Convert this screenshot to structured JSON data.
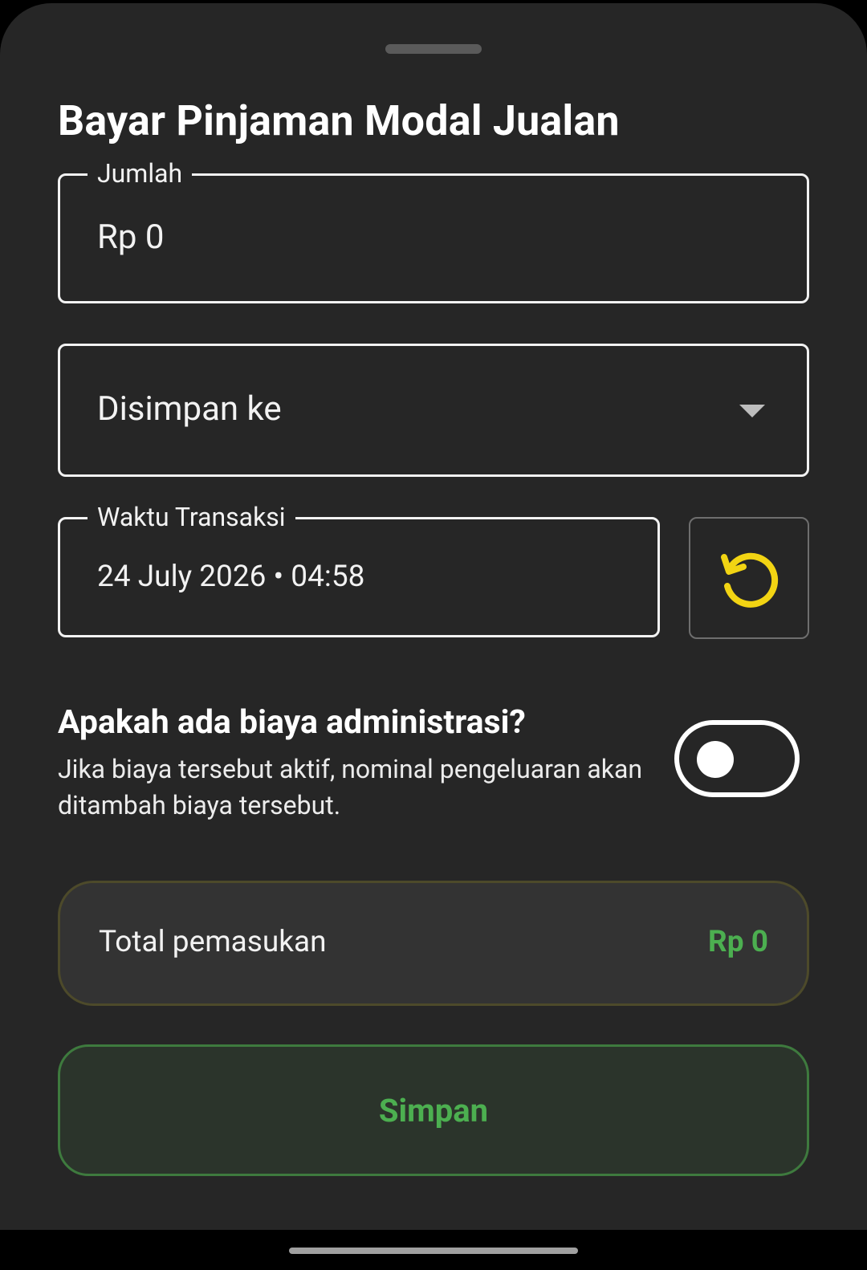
{
  "sheet": {
    "title": "Bayar Pinjaman Modal Jualan"
  },
  "form": {
    "amount": {
      "label": "Jumlah",
      "value": "Rp 0"
    },
    "account": {
      "placeholder": "Disimpan ke"
    },
    "transaction_time": {
      "label": "Waktu Transaksi",
      "value": "24 July 2026 • 04:58"
    },
    "reset_icon": "reset-refresh-icon",
    "admin_fee": {
      "title": "Apakah ada biaya administrasi?",
      "description": "Jika biaya tersebut aktif, nominal pengeluaran akan ditambah biaya tersebut.",
      "enabled": false
    }
  },
  "summary": {
    "label": "Total pemasukan",
    "value": "Rp 0"
  },
  "actions": {
    "save_label": "Simpan"
  },
  "colors": {
    "background": "#262626",
    "accent_green": "#4caf50",
    "reset_icon": "#f2d413"
  }
}
